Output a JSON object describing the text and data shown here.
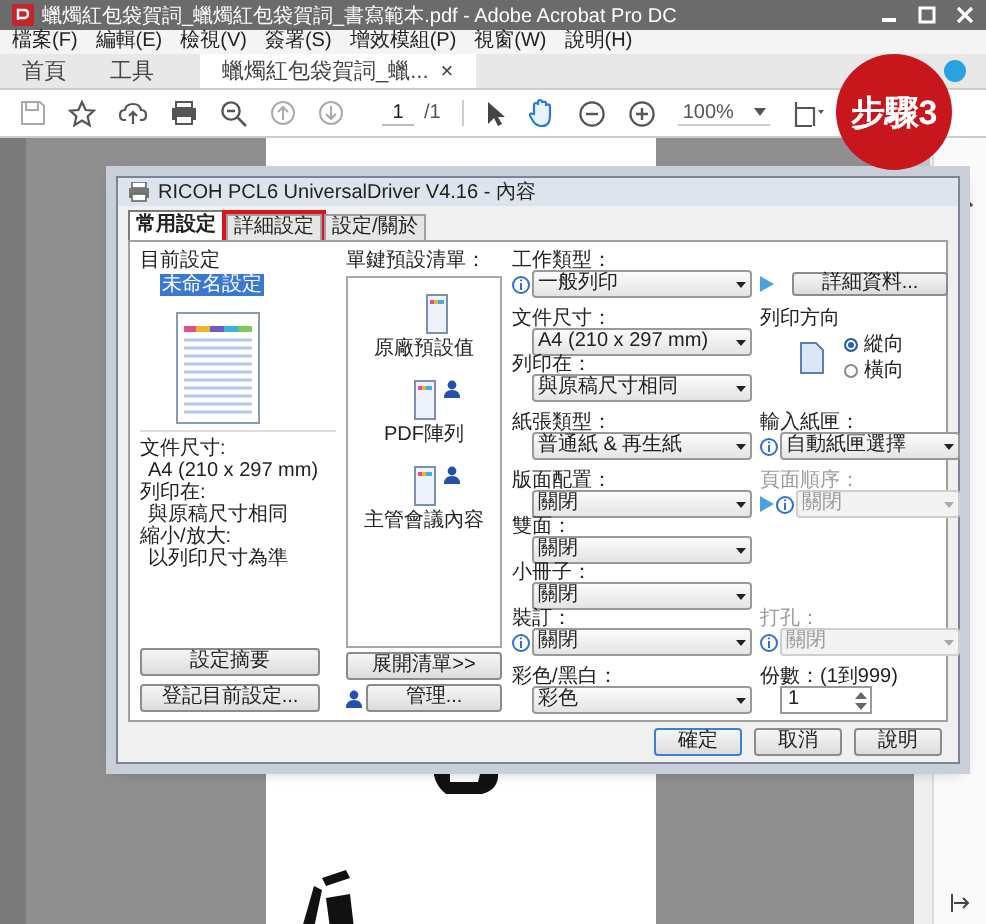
{
  "window": {
    "title": "蠟燭紅包袋賀詞_蠟燭紅包袋賀詞_書寫範本.pdf - Adobe Acrobat Pro DC"
  },
  "menu": [
    "檔案(F)",
    "編輯(E)",
    "檢視(V)",
    "簽署(S)",
    "增效模組(P)",
    "視窗(W)",
    "說明(H)"
  ],
  "tabs": [
    {
      "label": "首頁",
      "selected": false
    },
    {
      "label": "工具",
      "selected": false
    },
    {
      "label": "蠟燭紅包袋賀詞_蠟...",
      "selected": true,
      "close": "×"
    }
  ],
  "toolbar": {
    "page": "1",
    "total": "/1",
    "zoom": "100%"
  },
  "badge": "步驟3",
  "dialog": {
    "title": "RICOH PCL6 UniversalDriver V4.16 - 內容",
    "tabs": [
      {
        "label": "常用設定",
        "selected": true,
        "marked": false
      },
      {
        "label": "詳細設定",
        "selected": false,
        "marked": true
      },
      {
        "label": "設定/關於",
        "selected": false,
        "marked": false
      }
    ],
    "current": {
      "heading": "目前設定",
      "name": "未命名設定",
      "summary": [
        {
          "label": "文件尺寸:",
          "value": "A4 (210 x 297 mm)"
        },
        {
          "label": "列印在:",
          "value": "與原稿尺寸相同"
        },
        {
          "label": "縮小/放大:",
          "value": "以列印尺寸為準"
        }
      ],
      "buttons": [
        "設定摘要",
        "登記目前設定..."
      ]
    },
    "presets": {
      "heading": "單鍵預設清單：",
      "items": [
        {
          "label": "原廠預設值",
          "user": false
        },
        {
          "label": "PDF陣列",
          "user": true
        },
        {
          "label": "主管會議內容",
          "user": true
        }
      ],
      "buttons": [
        "展開清單>>",
        "管理..."
      ]
    },
    "sections": [
      {
        "rows": [
          {
            "fields": [
              {
                "kind": "select",
                "label": "工作類型：",
                "value": "一般列印",
                "info": true,
                "disabled": false
              },
              {
                "kind": "button",
                "label": "詳細資料...",
                "arrow": true
              }
            ]
          }
        ]
      },
      {
        "rows": [
          {
            "fields": [
              {
                "kind": "select",
                "label": "文件尺寸：",
                "value": "A4 (210 x 297 mm)",
                "disabled": false
              },
              {
                "kind": "radio",
                "label": "列印方向",
                "options": [
                  {
                    "label": "縱向",
                    "selected": true
                  },
                  {
                    "label": "橫向",
                    "selected": false
                  }
                ]
              }
            ]
          },
          {
            "fields": [
              {
                "kind": "select",
                "label": "列印在：",
                "value": "與原稿尺寸相同",
                "disabled": false
              }
            ]
          }
        ]
      },
      {
        "rows": [
          {
            "fields": [
              {
                "kind": "select",
                "label": "紙張類型：",
                "value": "普通紙 & 再生紙",
                "disabled": false
              },
              {
                "kind": "select",
                "label": "輸入紙匣：",
                "value": "自動紙匣選擇",
                "info": true,
                "disabled": false
              }
            ]
          }
        ]
      },
      {
        "rows": [
          {
            "fields": [
              {
                "kind": "select",
                "label": "版面配置：",
                "value": "關閉",
                "disabled": false
              },
              {
                "kind": "select",
                "label": "頁面順序：",
                "value": "關閉",
                "info": true,
                "arrow": true,
                "disabled": true
              }
            ]
          },
          {
            "fields": [
              {
                "kind": "select",
                "label": "雙面：",
                "value": "關閉",
                "disabled": false
              }
            ]
          },
          {
            "fields": [
              {
                "kind": "select",
                "label": "小冊子：",
                "value": "關閉",
                "disabled": false
              }
            ]
          },
          {
            "fields": [
              {
                "kind": "select",
                "label": "裝訂：",
                "value": "關閉",
                "info": true,
                "disabled": false
              },
              {
                "kind": "select",
                "label": "打孔：",
                "value": "關閉",
                "info": true,
                "disabled": true
              }
            ]
          }
        ]
      },
      {
        "rows": [
          {
            "fields": [
              {
                "kind": "select",
                "label": "彩色/黑白：",
                "value": "彩色",
                "disabled": false
              },
              {
                "kind": "spin",
                "label": "份數：(1到999)",
                "value": "1"
              }
            ]
          }
        ]
      }
    ],
    "footer": [
      "確定",
      "取消",
      "說明"
    ]
  }
}
